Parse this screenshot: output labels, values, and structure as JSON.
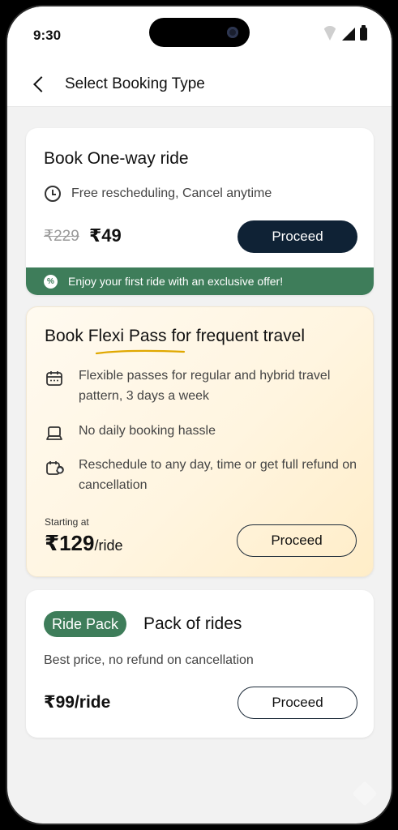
{
  "status_bar": {
    "time": "9:30"
  },
  "header": {
    "title": "Select Booking Type"
  },
  "one_way": {
    "title": "Book One-way ride",
    "feature": "Free rescheduling, Cancel anytime",
    "old_price": "₹229",
    "price": "₹49",
    "button": "Proceed",
    "offer": "Enjoy your first ride with an exclusive offer!"
  },
  "flexi": {
    "title": "Book Flexi Pass for frequent travel",
    "features": [
      "Flexible passes for regular and hybrid travel pattern, 3 days a week",
      "No daily booking hassle",
      "Reschedule to any day, time or get full refund on cancellation"
    ],
    "starting_label": "Starting at",
    "price": "₹129",
    "unit": "/ride",
    "button": "Proceed"
  },
  "ride_pack": {
    "tag": "Ride Pack",
    "title": "Pack of rides",
    "subtitle": "Best price, no refund on cancellation",
    "price": "₹99/ride",
    "button": "Proceed"
  },
  "colors": {
    "accent_green": "#3e7d5a",
    "dark_navy": "#0f2235",
    "underline": "#e0a800"
  },
  "icons": [
    "back-arrow-icon",
    "clock-icon",
    "offer-badge-icon",
    "calendar-icon",
    "laptop-icon",
    "calendar-refund-icon"
  ]
}
